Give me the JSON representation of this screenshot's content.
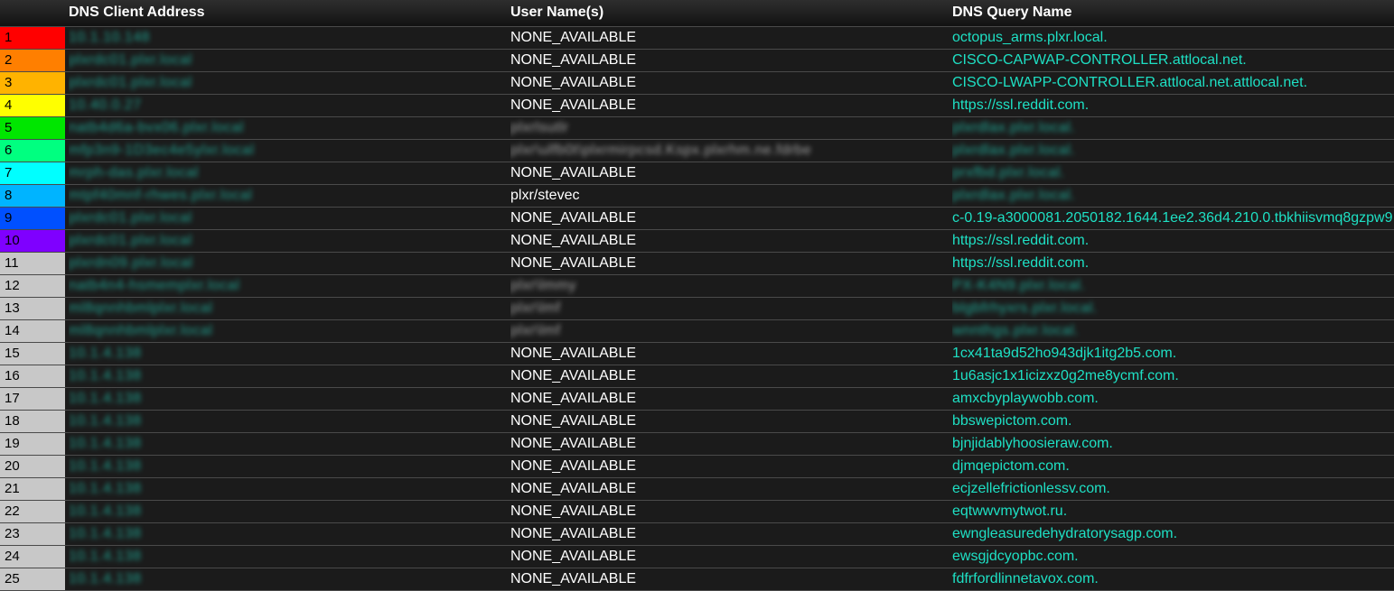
{
  "header": {
    "client": "DNS Client Address",
    "user": "User Name(s)",
    "query": "DNS Query Name"
  },
  "rank_colors": [
    "#ff0000",
    "#ff7f00",
    "#ffb300",
    "#ffff00",
    "#00e600",
    "#00ff80",
    "#00ffff",
    "#00b4ff",
    "#0050ff",
    "#7f00ff",
    "#c8c8c8",
    "#c8c8c8",
    "#c8c8c8",
    "#c8c8c8",
    "#c8c8c8",
    "#c8c8c8",
    "#c8c8c8",
    "#c8c8c8",
    "#c8c8c8",
    "#c8c8c8",
    "#c8c8c8",
    "#c8c8c8",
    "#c8c8c8",
    "#c8c8c8",
    "#c8c8c8"
  ],
  "rows": [
    {
      "rank": "1",
      "client": "10.1.10.148",
      "user": "NONE_AVAILABLE",
      "query": "octopus_arms.plxr.local."
    },
    {
      "rank": "2",
      "client": "plxrdc01.plxr.local",
      "user": "NONE_AVAILABLE",
      "query": "CISCO-CAPWAP-CONTROLLER.attlocal.net."
    },
    {
      "rank": "3",
      "client": "plxrdc01.plxr.local",
      "user": "NONE_AVAILABLE",
      "query": "CISCO-LWAPP-CONTROLLER.attlocal.net.attlocal.net."
    },
    {
      "rank": "4",
      "client": "10.40.0.27",
      "user": "NONE_AVAILABLE",
      "query": "https://ssl.reddit.com."
    },
    {
      "rank": "5",
      "client": "natb4d6a-bvx06.plxr.local",
      "user": "plxrlsutlr",
      "query": "plxrdlax.plxr.local."
    },
    {
      "rank": "6",
      "client": "mfp3n9-1D3ec4e5ylxr.local",
      "user": "plxr\\ulfb0t\\plxrmirpcsd.Kspx.plxrhm.ne.fdrbe",
      "query": "plxrdlax.plxr.local."
    },
    {
      "rank": "7",
      "client": "mrph-das.plxr.local",
      "user": "NONE_AVAILABLE",
      "query": "prxfbd.plxr.local."
    },
    {
      "rank": "8",
      "client": "mtpf40mnf-rhwes.plxr.local",
      "user": "plxr/stevec",
      "query": "plxrdlax.plxr.local."
    },
    {
      "rank": "9",
      "client": "plxrdc01.plxr.local",
      "user": "NONE_AVAILABLE",
      "query": "c-0.19-a3000081.2050182.1644.1ee2.36d4.210.0.tbkhiisvmq8gzpw9"
    },
    {
      "rank": "10",
      "client": "plxrdc01.plxr.local",
      "user": "NONE_AVAILABLE",
      "query": "https://ssl.reddit.com."
    },
    {
      "rank": "11",
      "client": "plxrdn09.plxr.local",
      "user": "NONE_AVAILABLE",
      "query": "https://ssl.reddit.com."
    },
    {
      "rank": "12",
      "client": "natb4n4-hsmemplxr.local",
      "user": "plxr\\lmmy",
      "query": "PX-K4N9.plxr.local."
    },
    {
      "rank": "13",
      "client": "ml8qnnhbmlplxr.local",
      "user": "plxr\\lmf",
      "query": "blgbfrhyxrs.plxr.local."
    },
    {
      "rank": "14",
      "client": "ml8qnnhbmlplxr.local",
      "user": "plxr\\lmf",
      "query": "wnnthgs.plxr.local."
    },
    {
      "rank": "15",
      "client": "10.1.4.138",
      "user": "NONE_AVAILABLE",
      "query": "1cx41ta9d52ho943djk1itg2b5.com."
    },
    {
      "rank": "16",
      "client": "10.1.4.138",
      "user": "NONE_AVAILABLE",
      "query": "1u6asjc1x1icizxz0g2me8ycmf.com."
    },
    {
      "rank": "17",
      "client": "10.1.4.138",
      "user": "NONE_AVAILABLE",
      "query": "amxcbyplaywobb.com."
    },
    {
      "rank": "18",
      "client": "10.1.4.138",
      "user": "NONE_AVAILABLE",
      "query": "bbswepictom.com."
    },
    {
      "rank": "19",
      "client": "10.1.4.138",
      "user": "NONE_AVAILABLE",
      "query": "bjnjidablyhoosieraw.com."
    },
    {
      "rank": "20",
      "client": "10.1.4.138",
      "user": "NONE_AVAILABLE",
      "query": "djmqepictom.com."
    },
    {
      "rank": "21",
      "client": "10.1.4.138",
      "user": "NONE_AVAILABLE",
      "query": "ecjzellefrictionlessv.com."
    },
    {
      "rank": "22",
      "client": "10.1.4.138",
      "user": "NONE_AVAILABLE",
      "query": "eqtwwvmytwot.ru."
    },
    {
      "rank": "23",
      "client": "10.1.4.138",
      "user": "NONE_AVAILABLE",
      "query": "ewngleasuredehydratorysagp.com."
    },
    {
      "rank": "24",
      "client": "10.1.4.138",
      "user": "NONE_AVAILABLE",
      "query": "ewsgjdcyopbc.com."
    },
    {
      "rank": "25",
      "client": "10.1.4.138",
      "user": "NONE_AVAILABLE",
      "query": "fdfrfordlinnetavox.com."
    }
  ],
  "blurred": {
    "client": [
      true,
      true,
      true,
      true,
      true,
      true,
      true,
      true,
      true,
      true,
      true,
      true,
      true,
      true,
      true,
      true,
      true,
      true,
      true,
      true,
      true,
      true,
      true,
      true,
      true
    ],
    "user": [
      false,
      false,
      false,
      false,
      true,
      true,
      false,
      false,
      false,
      false,
      false,
      true,
      true,
      true,
      false,
      false,
      false,
      false,
      false,
      false,
      false,
      false,
      false,
      false,
      false
    ],
    "query": [
      false,
      false,
      false,
      false,
      true,
      true,
      true,
      true,
      false,
      false,
      false,
      true,
      true,
      true,
      false,
      false,
      false,
      false,
      false,
      false,
      false,
      false,
      false,
      false,
      false
    ]
  }
}
